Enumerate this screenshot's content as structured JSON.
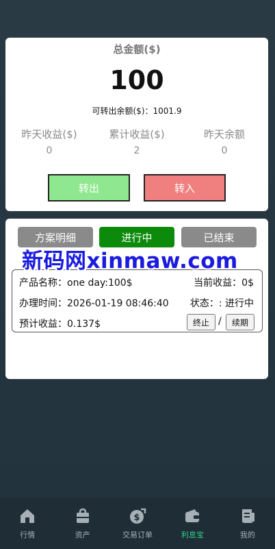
{
  "summary": {
    "total_label": "总金额($)",
    "total_value": "100",
    "available": "可转出余额($)：1001.9",
    "stats": [
      {
        "label": "昨天收益($)",
        "value": "0"
      },
      {
        "label": "累计收益($)",
        "value": "2"
      },
      {
        "label": "昨天余额",
        "value": "0"
      }
    ],
    "transfer_out_label": "转出",
    "transfer_in_label": "转入"
  },
  "tabs": [
    {
      "label": "方案明细"
    },
    {
      "label": "进行中"
    },
    {
      "label": "已结束"
    }
  ],
  "watermark": "新码网xinmaw.com",
  "order": {
    "product": "产品名称：one day:100$",
    "current_income": "当前收益：0$",
    "time": "办理时间：2026-01-19 08:46:40",
    "status": "状态：: 进行中",
    "expected": "预计收益：0.137$",
    "stop_label": "终止",
    "separator": "/",
    "renew_label": "续期"
  },
  "tabbar": {
    "items": [
      {
        "label": "行情",
        "icon": "home-icon"
      },
      {
        "label": "资产",
        "icon": "bag-icon"
      },
      {
        "label": "交易订单",
        "icon": "money-icon"
      },
      {
        "label": "利息宝",
        "icon": "wallet-icon"
      },
      {
        "label": "我的",
        "icon": "profile-icon"
      }
    ],
    "active_color": "#2fd18a",
    "inactive_color": "#a6b0b6"
  }
}
